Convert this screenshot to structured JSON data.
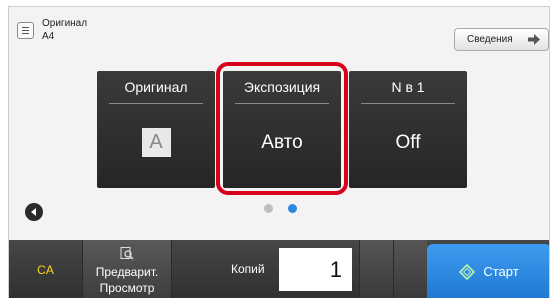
{
  "original_info": {
    "label": "Оригинал",
    "size": "A4"
  },
  "details_button": {
    "label": "Сведения"
  },
  "cards": [
    {
      "title": "Оригинал",
      "value": "A"
    },
    {
      "title": "Экспозиция",
      "value": "Авто"
    },
    {
      "title": "N в 1",
      "value": "Off"
    }
  ],
  "page_indicator": {
    "current": 2,
    "total": 2
  },
  "bottom": {
    "ca_label": "CA",
    "preview_line1": "Предварит.",
    "preview_line2": "Просмотр",
    "copies_label": "Копий",
    "copies_value": "1",
    "start_label": "Старт"
  },
  "colors": {
    "highlight": "#d6001c",
    "start": "#2a89e0",
    "ca_text": "#ffd21e",
    "active_dot": "#2a89e0"
  }
}
